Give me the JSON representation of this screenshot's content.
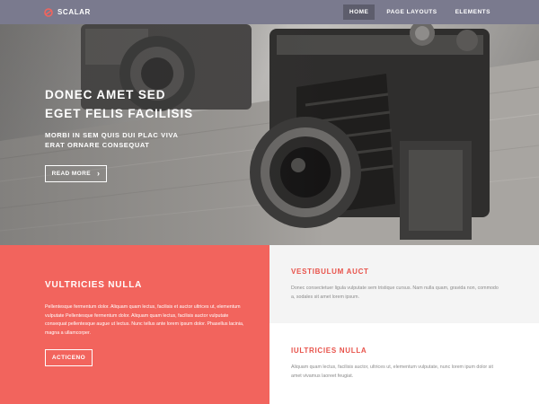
{
  "nav": {
    "brand": "SCALAR",
    "links": [
      "HOME",
      "PAGE LAYOUTS",
      "ELEMENTS"
    ],
    "active_index": 0
  },
  "hero": {
    "title": "DONEC AMET SED\nEGET FELIS FACILISIS",
    "title_lines": [
      "DONEC AMET SED",
      "EGET FELIS FACILISIS"
    ],
    "subtitle_lines": [
      "MORBI IN SEM QUIS DUI PLAC VIVA",
      "ERAT ORNARE CONSEQUAT"
    ],
    "button_label": "READ MORE"
  },
  "feature_left": {
    "heading": "VULTRICIES NULLA",
    "body": "Pellentesque fermentum dolor. Aliquam quam lectus, facilisis et auctor ultrices ut, elementum vulputate Pellentesque fermentum dolor. Aliquam quam lectus, facilisis auctor vulputate consequat pellentesque augue ut lectus. Nunc tellus ante lorem ipsum dolor. Phasellus lacinia, magna a ullamcorper.",
    "button_label": "ACTICENO"
  },
  "feature_right_top": {
    "heading": "VESTIBULUM AUCT",
    "body": "Donec consectetuer ligula vulputate sem tristique cursus. Nam nulla quam, gravida non, commodo a, sodales sit amet lorem ipsum."
  },
  "feature_right_bottom": {
    "heading": "IULTRICIES NULLA",
    "body": "Aliquam quam lectus, facilisis auctor, ultrices ut, elementum vulputate, nunc lorem ipum dolor sit amet vivamus laoreet feugiat."
  },
  "colors": {
    "nav_bg": "#7a7a8e",
    "nav_active_bg": "#5d5d6c",
    "accent_coral": "#f2645d",
    "heading_red": "#e8524a",
    "body_gray": "#8a8a8a"
  },
  "icons": {
    "brand_logo": "scalar-logo-icon",
    "button_arrow": "chevron-right-icon"
  }
}
